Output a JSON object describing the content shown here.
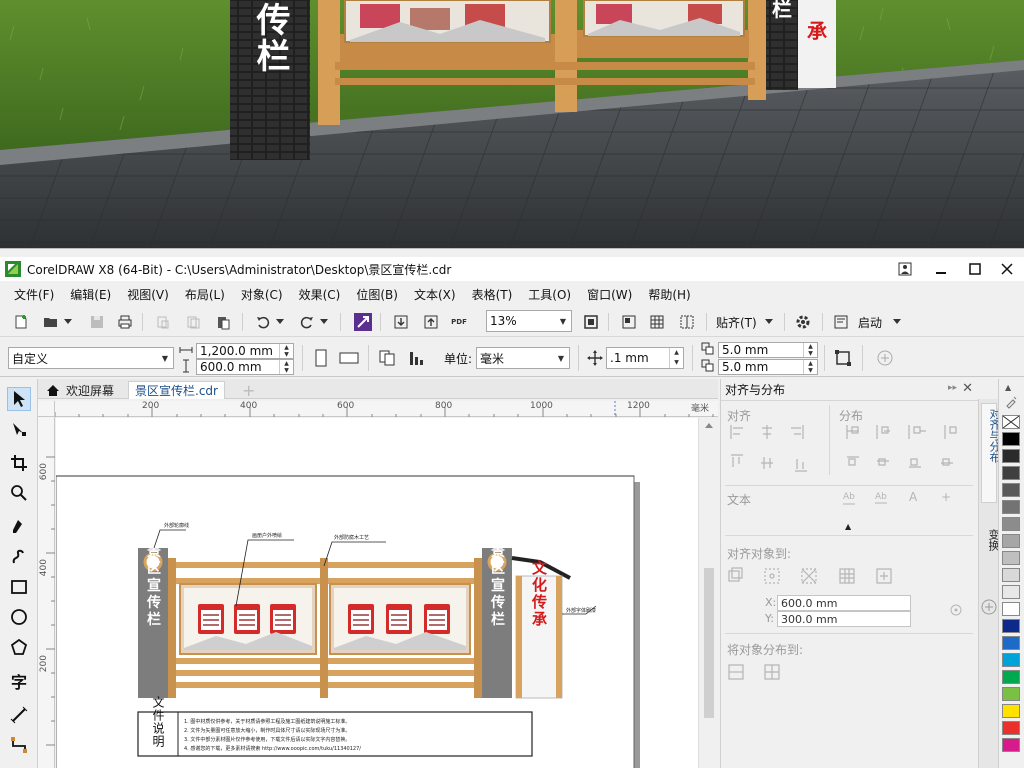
{
  "photo": {
    "sign_left": "宣传栏",
    "sign_right": "承"
  },
  "window": {
    "title": "CorelDRAW X8 (64-Bit) - C:\\Users\\Administrator\\Desktop\\景区宣传栏.cdr",
    "controls": [
      "minimize",
      "maximize",
      "close"
    ]
  },
  "menu": [
    "文件(F)",
    "编辑(E)",
    "视图(V)",
    "布局(L)",
    "对象(C)",
    "效果(C)",
    "位图(B)",
    "文本(X)",
    "表格(T)",
    "工具(O)",
    "窗口(W)",
    "帮助(H)"
  ],
  "toolbar1": {
    "zoom": "13%",
    "snap_label": "贴齐(T)",
    "launch_label": "启动",
    "pdf_label": "PDF"
  },
  "toolbar2": {
    "page_preset": "自定义",
    "width": "1,200.0 mm",
    "height": "600.0 mm",
    "unit_label": "单位:",
    "unit": "毫米",
    "nudge": ".1 mm",
    "dup_x": "5.0 mm",
    "dup_y": "5.0 mm"
  },
  "tabs": [
    {
      "label": "欢迎屏幕",
      "active": false
    },
    {
      "label": "景区宣传栏.cdr",
      "active": true
    }
  ],
  "ruler": {
    "h_ticks": [
      "200",
      "400",
      "600",
      "800",
      "1000",
      "1200"
    ],
    "h_unit": "毫米",
    "v_ticks": [
      "600",
      "400",
      "200"
    ]
  },
  "drawing": {
    "left_panel": "景区宣传栏",
    "right_panel": "景区宣传栏",
    "culture": "文化传承",
    "callout_1": "外部轮廓线",
    "callout_2": "画册户外喷绘",
    "callout_3": "外部防腐木工艺",
    "callout_4": "外部字体刷漆",
    "note_title": "文件说明",
    "note_lines": [
      "1. 图中材质仅供参考，关于材质请参照工程及施工图纸建筑说明施工标准。",
      "2. 文件为矢量图可任意放大缩小，制作时具体尺寸请以实际现场尺寸为准。",
      "3. 文件中部分素材图片仅作参考使用，下载文件后请以实际文字内容替换。",
      "4. 感谢您的下载，更多素材请搜索 http://www.ooopic.com/tuku/11340127/"
    ]
  },
  "docker": {
    "title": "对齐与分布",
    "sec_align": "对齐",
    "sec_distribute": "分布",
    "sec_text": "文本",
    "sec_align_to": "对齐对象到:",
    "x_value": "600.0 mm",
    "y_value": "300.0 mm",
    "x_label": "X:",
    "y_label": "Y:",
    "sec_distribute_to": "将对象分布到:"
  },
  "side_tabs": [
    "对齐与分布",
    "变换"
  ],
  "palette": [
    "#ffffff",
    "#000000",
    "#2b2b2b",
    "#404040",
    "#595959",
    "#737373",
    "#8c8c8c",
    "#a6a6a6",
    "#bfbfbf",
    "#d9d9d9",
    "#e8e8e8",
    "#ffffff",
    "#0d2a8a",
    "#1e6ac8",
    "#00a3d9",
    "#00a84f",
    "#7ac143",
    "#ffe100",
    "#e9302b",
    "#d81b8a"
  ]
}
